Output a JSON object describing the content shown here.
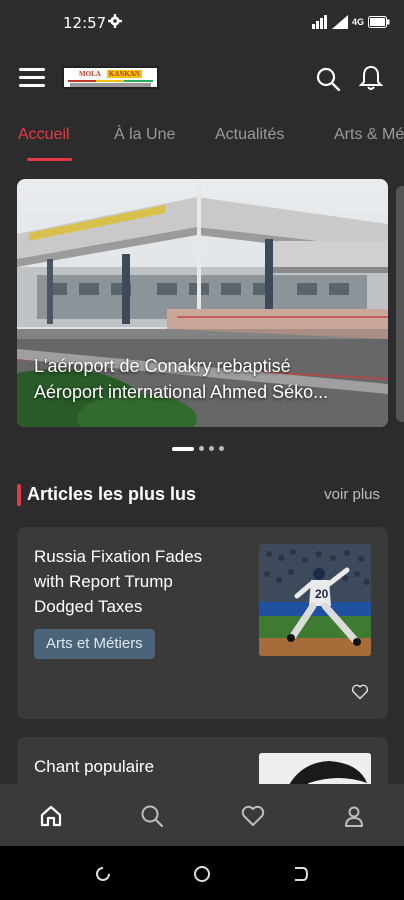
{
  "status_bar": {
    "time": "12:57",
    "network_label": "4G"
  },
  "header": {
    "logo_text_1": "MOLA",
    "logo_text_2": "KANKAN"
  },
  "tabs": [
    {
      "label": "Accueil",
      "active": true
    },
    {
      "label": "À la Une",
      "active": false
    },
    {
      "label": "Actualités",
      "active": false
    },
    {
      "label": "Arts & Mé",
      "active": false
    }
  ],
  "carousel": {
    "caption_line1": "L'aéroport de Conakry rebaptisé",
    "caption_line2": "Aéroport international Ahmed Sékо...",
    "dots_count": 4,
    "active_dot": 0
  },
  "section": {
    "title": "Articles les plus lus",
    "see_more": "voir plus"
  },
  "articles": [
    {
      "title": "Russia Fixation Fades with Report Trump Dodged Taxes",
      "category": "Arts et Métiers",
      "thumb_icon": "baseball-pitcher-photo"
    },
    {
      "title": "Chant populaire",
      "thumb_icon": "portrait-photo"
    }
  ],
  "bottom_nav": [
    "home-icon",
    "search-icon",
    "heart-icon",
    "profile-icon"
  ],
  "colors": {
    "accent": "#e63946",
    "background": "#2c2c2c",
    "card": "#3a3a3a",
    "tag": "#4b6478"
  }
}
